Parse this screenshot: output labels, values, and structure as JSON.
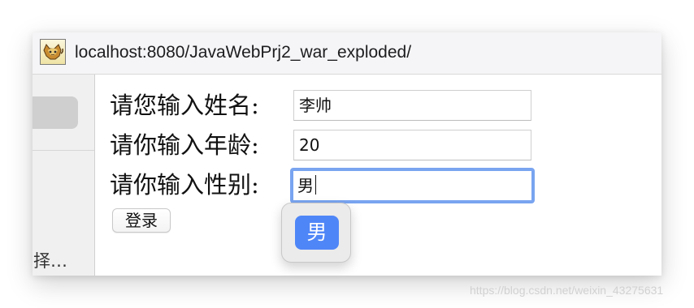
{
  "browser": {
    "url": "localhost:8080/JavaWebPrj2_war_exploded/",
    "favicon_icon": "tomcat-cat-icon"
  },
  "sidebar": {
    "partial_label": "择…"
  },
  "form": {
    "name_label": "请您输入姓名:",
    "name_value": "李帅",
    "age_label": "请你输入年龄:",
    "age_value": "20",
    "gender_label": "请你输入性别:",
    "gender_value": "男",
    "login_button": "登录"
  },
  "ime": {
    "candidate": "男"
  },
  "watermark": {
    "text": "https://blog.csdn.net/weixin_43275631"
  },
  "colors": {
    "focus_ring": "#79a4f0",
    "ime_candidate_bg": "#4f86f7"
  }
}
